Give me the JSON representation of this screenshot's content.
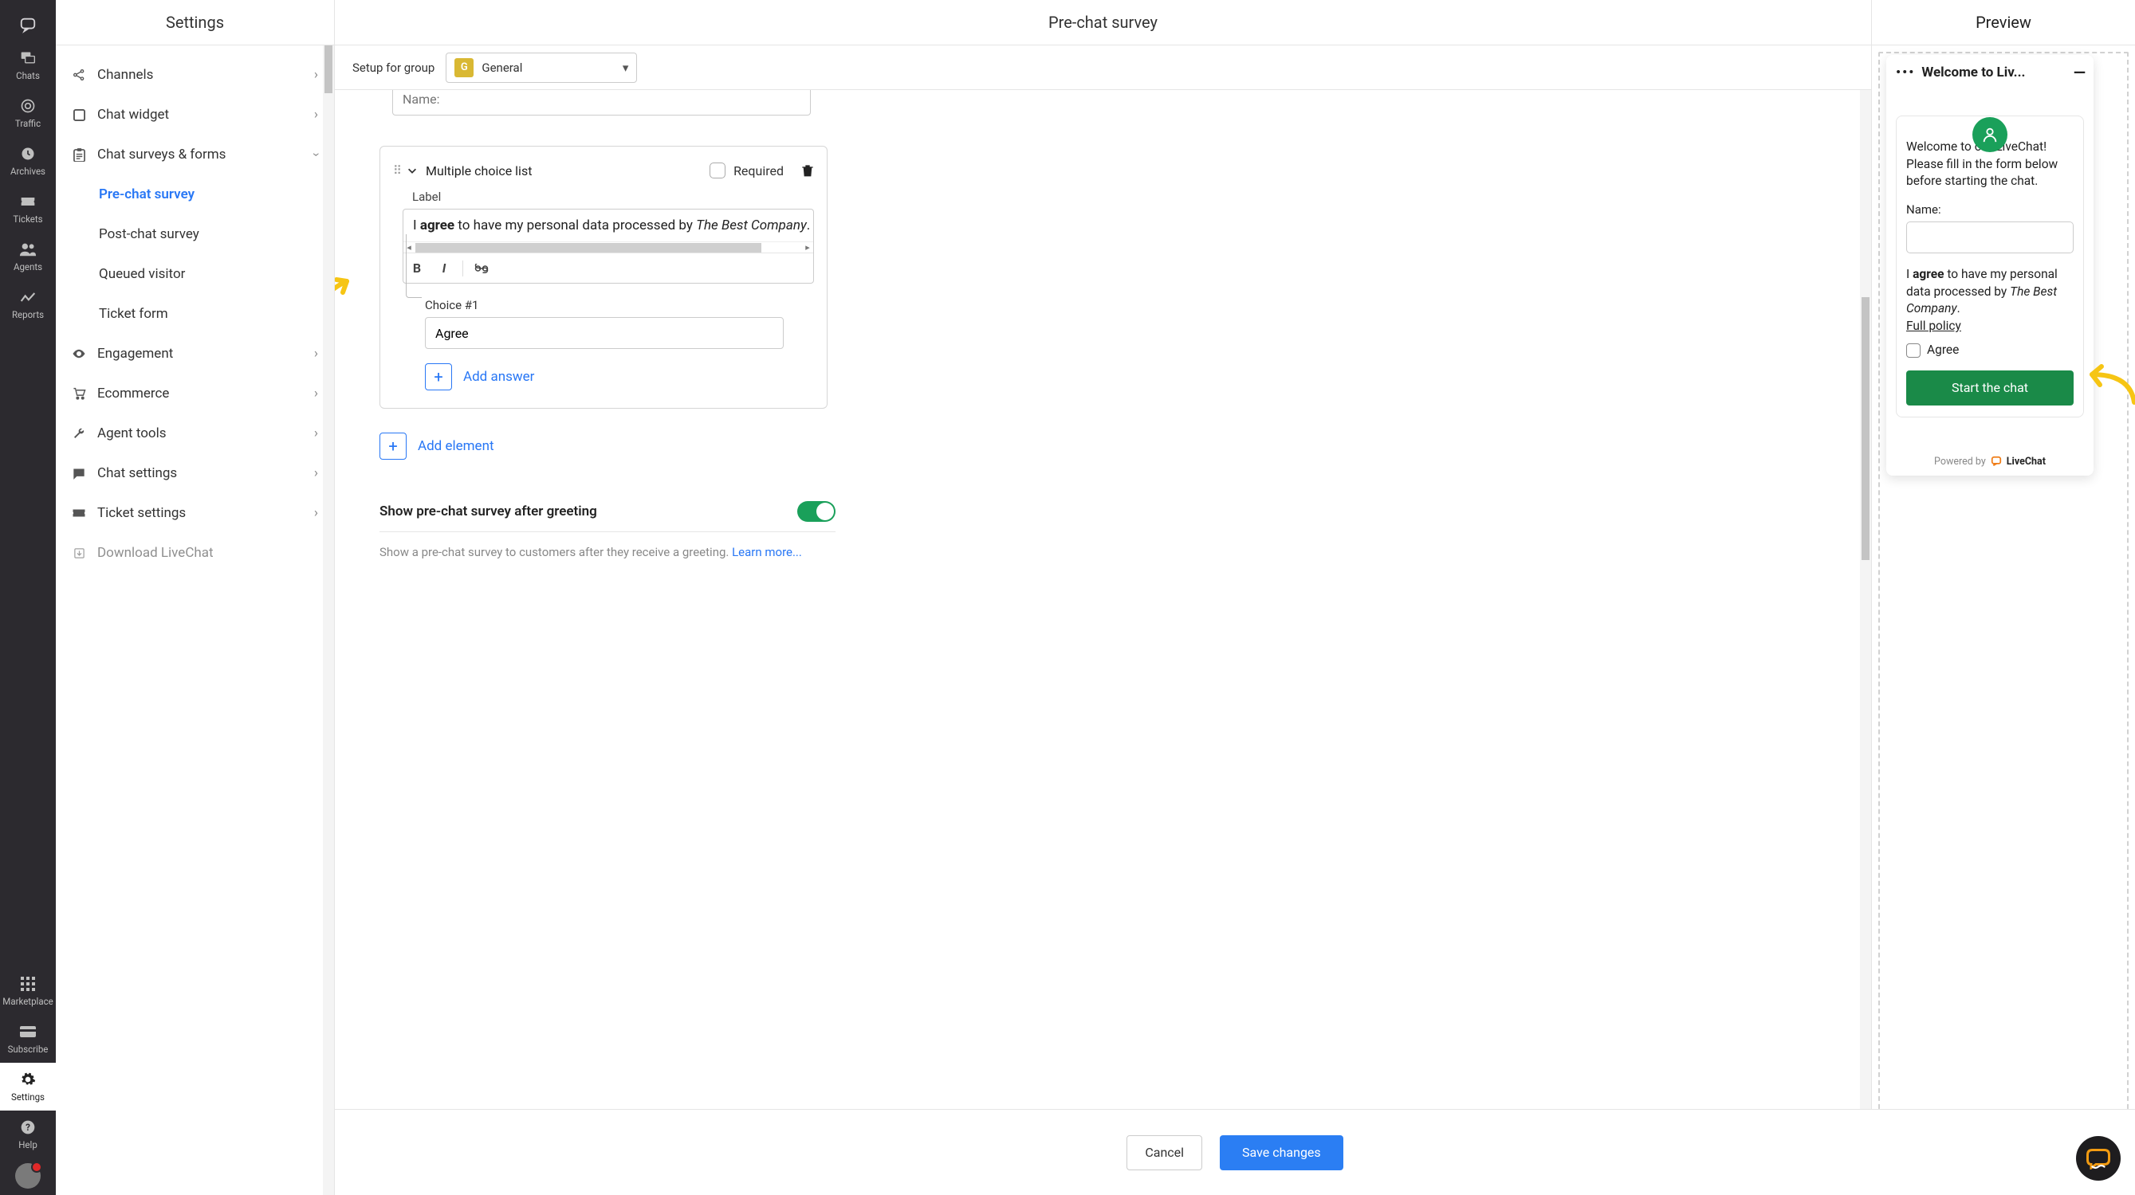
{
  "rail": {
    "logo": "chat-bubble",
    "items": [
      {
        "label": "Chats",
        "icon": "chats"
      },
      {
        "label": "Traffic",
        "icon": "traffic"
      },
      {
        "label": "Archives",
        "icon": "clock"
      },
      {
        "label": "Tickets",
        "icon": "ticket"
      },
      {
        "label": "Agents",
        "icon": "people"
      },
      {
        "label": "Reports",
        "icon": "reports"
      }
    ],
    "bottom": [
      {
        "label": "Marketplace",
        "icon": "grid"
      },
      {
        "label": "Subscribe",
        "icon": "card"
      },
      {
        "label": "Settings",
        "icon": "gear",
        "active": true
      },
      {
        "label": "Help",
        "icon": "help"
      }
    ]
  },
  "settings": {
    "title": "Settings",
    "menu": [
      {
        "label": "Channels",
        "icon": "share"
      },
      {
        "label": "Chat widget",
        "icon": "square"
      },
      {
        "label": "Chat surveys & forms",
        "icon": "clipboard",
        "expanded": true,
        "children": [
          {
            "label": "Pre-chat survey",
            "active": true
          },
          {
            "label": "Post-chat survey"
          },
          {
            "label": "Queued visitor"
          },
          {
            "label": "Ticket form"
          }
        ]
      },
      {
        "label": "Engagement",
        "icon": "eye"
      },
      {
        "label": "Ecommerce",
        "icon": "cart"
      },
      {
        "label": "Agent tools",
        "icon": "wrench"
      },
      {
        "label": "Chat settings",
        "icon": "message"
      },
      {
        "label": "Ticket settings",
        "icon": "ticket2"
      },
      {
        "label": "Download LiveChat",
        "icon": "download"
      }
    ]
  },
  "main": {
    "title": "Pre-chat survey",
    "group_label": "Setup for group",
    "group_badge": "G",
    "group_value": "General",
    "name_placeholder": "Name:",
    "card": {
      "type": "Multiple choice list",
      "required": "Required",
      "label_title": "Label",
      "label_prefix": "I ",
      "label_bold": "agree",
      "label_mid": " to have my personal data processed by ",
      "label_italic": "The Best Company",
      "label_after": ". ",
      "label_link": "Full p",
      "choice1_title": "Choice #1",
      "choice1_value": "Agree",
      "add_answer": "Add answer"
    },
    "add_element": "Add element",
    "show_title": "Show pre-chat survey after greeting",
    "show_desc": "Show a pre-chat survey to customers after they receive a greeting. ",
    "learn_more": "Learn more..."
  },
  "preview": {
    "title": "Preview",
    "widget_title": "Welcome to Liv...",
    "greet": "Welcome to our LiveChat!\nPlease fill in the form below before starting the chat.",
    "name_label": "Name:",
    "agree_prefix": "I ",
    "agree_bold": "agree",
    "agree_mid": " to have my personal data processed by ",
    "agree_italic": "The Best Company",
    "agree_dot": ".",
    "full_policy": "Full policy",
    "agree_checkbox": "Agree",
    "start_btn": "Start the chat",
    "powered": "Powered by",
    "brand": "LiveChat"
  },
  "footer": {
    "cancel": "Cancel",
    "save": "Save changes"
  }
}
